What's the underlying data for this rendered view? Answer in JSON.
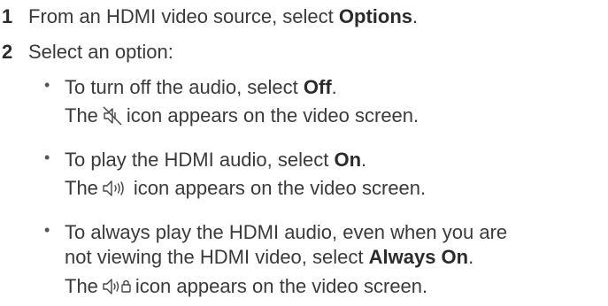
{
  "steps": [
    {
      "number": "1",
      "text_before": "From an HDMI video source, select ",
      "bold": "Options",
      "text_after": "."
    },
    {
      "number": "2",
      "text": "Select an option:"
    }
  ],
  "options": [
    {
      "bullet": "•",
      "text_before": "To turn off the audio, select ",
      "bold": "Off",
      "text_after": ".",
      "result_before": "The",
      "icon": "speaker-muted-icon",
      "result_after": "icon appears on the video screen."
    },
    {
      "bullet": "•",
      "text_before": "To play the HDMI audio, select ",
      "bold": "On",
      "text_after": ".",
      "result_before": "The",
      "icon": "speaker-on-icon",
      "result_after": "icon appears on the video screen."
    },
    {
      "bullet": "•",
      "line1": "To always play the HDMI audio, even when you are",
      "text_before": "not viewing the HDMI video, select ",
      "bold": "Always On",
      "text_after": ".",
      "result_before": "The",
      "icon": "speaker-always-on-icon",
      "result_after": "icon appears on the video screen."
    }
  ]
}
